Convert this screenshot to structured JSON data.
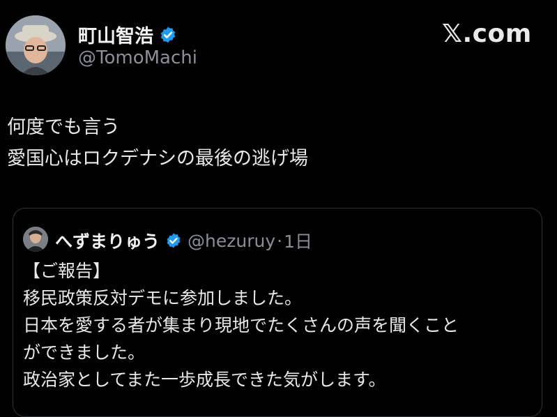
{
  "author": {
    "name": "町山智浩",
    "handle": "@TomoMachi",
    "verified_color": "#1d9bf0"
  },
  "watermark": "𝕏.com",
  "tweet": {
    "lines": [
      "何度でも言う",
      "愛国心はロクデナシの最後の逃げ場"
    ]
  },
  "quote": {
    "name": "へずまりゅう",
    "handle": "@hezuruy",
    "separator": "·",
    "time": "1日",
    "lines": [
      "【ご報告】",
      "移民政策反対デモに参加しました。",
      "日本を愛する者が集まり現地でたくさんの声を聞くこと",
      "ができました。",
      "政治家としてまた一歩成長できた気がします。"
    ]
  }
}
